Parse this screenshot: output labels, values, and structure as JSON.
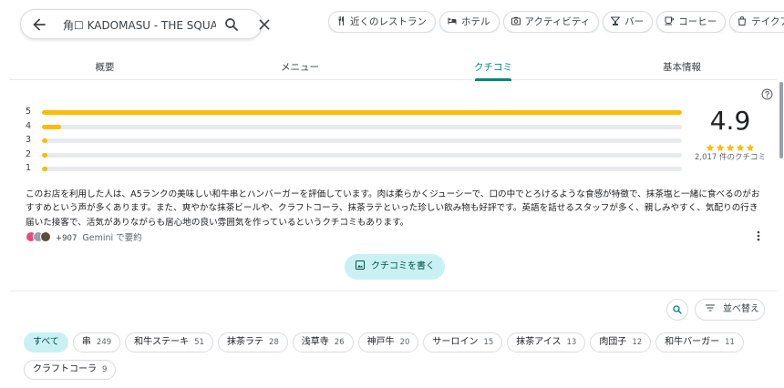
{
  "search": {
    "query": "角☐ KADOMASU - THE SQUA"
  },
  "chips": [
    {
      "icon": "fork-knife-icon",
      "label": "近くのレストラン"
    },
    {
      "icon": "bed-icon",
      "label": "ホテル"
    },
    {
      "icon": "camera-icon",
      "label": "アクティビティ"
    },
    {
      "icon": "cocktail-icon",
      "label": "バー"
    },
    {
      "icon": "coffee-icon",
      "label": "コーヒー"
    },
    {
      "icon": "bag-icon",
      "label": "テイクアウト"
    }
  ],
  "tabs": [
    {
      "label": "概要"
    },
    {
      "label": "メニュー"
    },
    {
      "label": "クチコミ"
    },
    {
      "label": "基本情報"
    }
  ],
  "active_tab": "クチコミ",
  "rating": {
    "average": "4.9",
    "stars_shown": 5,
    "count_label": "2,017 件のクチコミ",
    "breakdown": [
      {
        "level": "5",
        "fraction": 1.0
      },
      {
        "level": "4",
        "fraction": 0.03
      },
      {
        "level": "3",
        "fraction": 0.005
      },
      {
        "level": "2",
        "fraction": 0.003
      },
      {
        "level": "1",
        "fraction": 0.004
      }
    ]
  },
  "ai_summary": {
    "text": "このお店を利用した人は、A5ランクの美味しい和牛串とハンバーガーを評価しています。肉は柔らかくジューシーで、口の中でとろけるような食感が特徴で、抹茶塩と一緒に食べるのがおすすめという声が多くあります。また、爽やかな抹茶ビールや、クラフトコーラ、抹茶ラテといった珍しい飲み物も好評です。英語を話せるスタッフが多く、親しみやすく、気配りの行き届いた接客で、活気がありながらも居心地の良い雰囲気を作っているというクチコミもあります。",
    "extra_count": "+907",
    "source_label": "Gemini で要約",
    "avatar_colors": [
      "#e84a7f",
      "#9aa0a6",
      "#5f4b3b"
    ]
  },
  "write_review_label": "クチコミを書く",
  "sort_label": "並べ替え",
  "topics": [
    {
      "label": "すべて",
      "count": "",
      "selected": true
    },
    {
      "label": "串",
      "count": "249"
    },
    {
      "label": "和牛ステーキ",
      "count": "51"
    },
    {
      "label": "抹茶ラテ",
      "count": "28"
    },
    {
      "label": "浅草寺",
      "count": "26"
    },
    {
      "label": "神戸牛",
      "count": "20"
    },
    {
      "label": "サーロイン",
      "count": "15"
    },
    {
      "label": "抹茶アイス",
      "count": "13"
    },
    {
      "label": "肉団子",
      "count": "12"
    },
    {
      "label": "和牛バーガー",
      "count": "11"
    },
    {
      "label": "クラフトコーラ",
      "count": "9"
    }
  ],
  "colors": {
    "accent": "#00857a",
    "star": "#fbbc04",
    "chip_selected": "#c9f1f4"
  }
}
